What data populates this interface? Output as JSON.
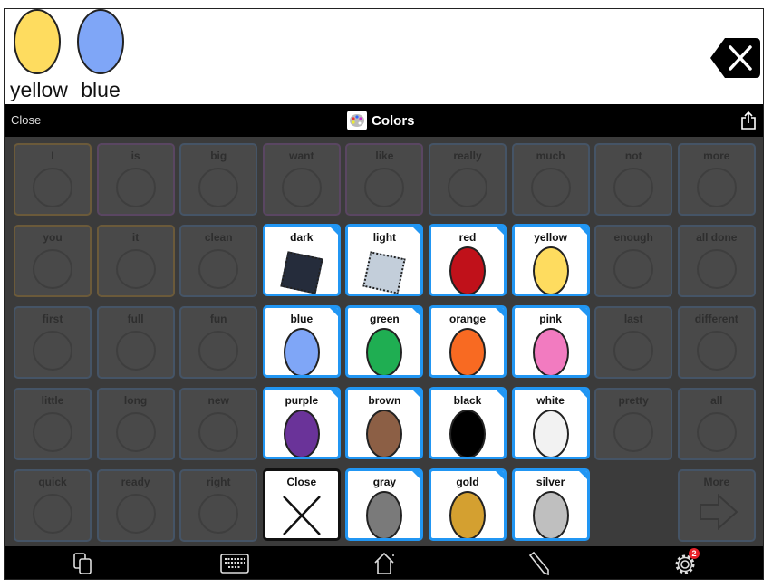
{
  "message_bar": {
    "words": [
      {
        "label": "yellow",
        "color": "#fedc5f"
      },
      {
        "label": "blue",
        "color": "#7fa6f7"
      }
    ],
    "delete_icon": "backspace-x-icon"
  },
  "top_bar": {
    "close_label": "Close",
    "title": "Colors",
    "title_icon": "palette-icon",
    "share_icon": "share-icon"
  },
  "background_grid": [
    [
      "I",
      "is",
      "big",
      "want",
      "like",
      "really",
      "much",
      "not",
      "more"
    ],
    [
      "you",
      "it",
      "clean",
      "",
      "",
      "",
      "",
      "enough",
      "all done"
    ],
    [
      "first",
      "full",
      "fun",
      "",
      "",
      "",
      "",
      "last",
      "different"
    ],
    [
      "little",
      "long",
      "new",
      "",
      "",
      "",
      "",
      "pretty",
      "all"
    ],
    [
      "quick",
      "ready",
      "right",
      "",
      "",
      "",
      "",
      "",
      "More"
    ]
  ],
  "colors_popup": [
    [
      {
        "label": "dark",
        "shape": "square",
        "color": "#252c3b"
      },
      {
        "label": "light",
        "shape": "square",
        "color": "#c3ceda"
      },
      {
        "label": "red",
        "shape": "oval",
        "color": "#c0111a"
      },
      {
        "label": "yellow",
        "shape": "oval",
        "color": "#fedc5f"
      }
    ],
    [
      {
        "label": "blue",
        "shape": "oval",
        "color": "#7fa6f7"
      },
      {
        "label": "green",
        "shape": "oval",
        "color": "#1fae52"
      },
      {
        "label": "orange",
        "shape": "oval",
        "color": "#f86a22"
      },
      {
        "label": "pink",
        "shape": "oval",
        "color": "#f27bc0"
      }
    ],
    [
      {
        "label": "purple",
        "shape": "oval",
        "color": "#6a3399"
      },
      {
        "label": "brown",
        "shape": "oval",
        "color": "#8c5f45"
      },
      {
        "label": "black",
        "shape": "oval",
        "color": "#000000"
      },
      {
        "label": "white",
        "shape": "oval",
        "color": "#f2f2f2"
      }
    ],
    [
      {
        "label": "Close",
        "shape": "x",
        "color": "#000000"
      },
      {
        "label": "gray",
        "shape": "oval",
        "color": "#7a7a7a"
      },
      {
        "label": "gold",
        "shape": "oval",
        "color": "#d4a030"
      },
      {
        "label": "silver",
        "shape": "oval",
        "color": "#bfbfbf"
      }
    ]
  ],
  "bottom_bar": {
    "icons": [
      "copy-pages-icon",
      "keyboard-icon",
      "home-icon",
      "pencil-icon",
      "gear-icon"
    ],
    "settings_badge": "2"
  },
  "accent_color": "#2196f3"
}
